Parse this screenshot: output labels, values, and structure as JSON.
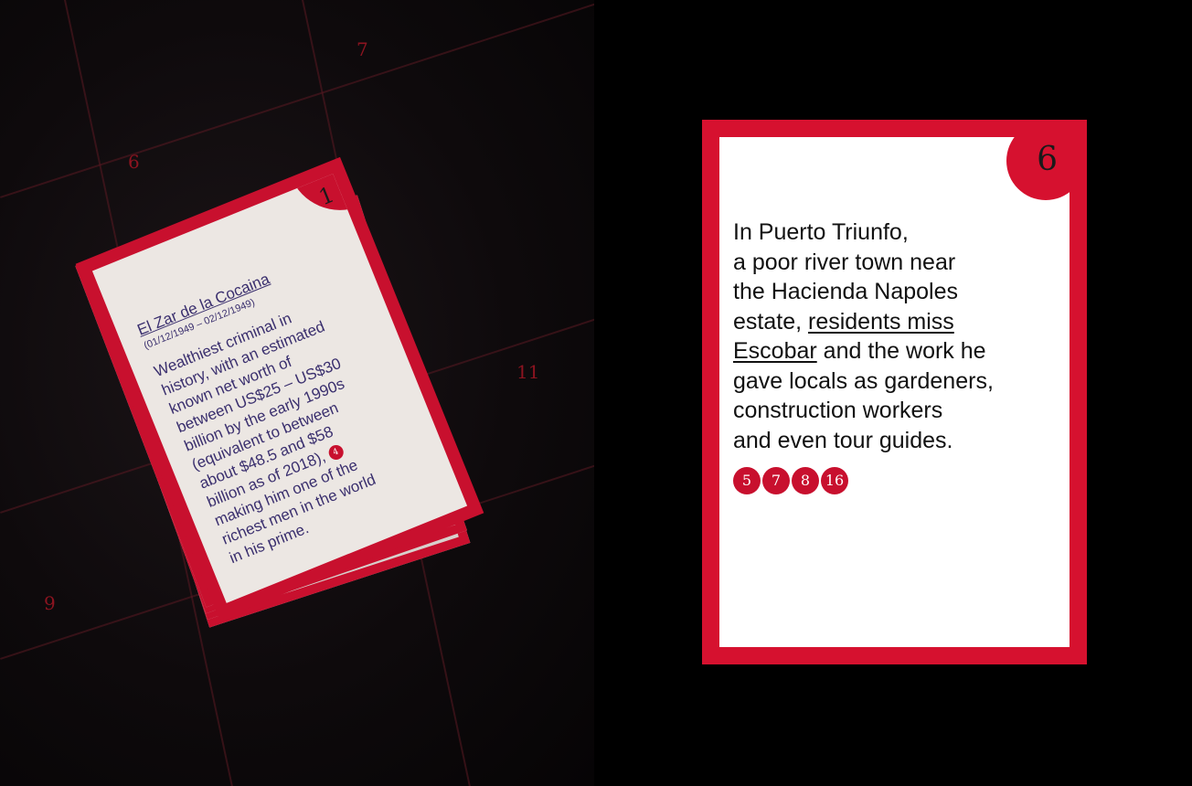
{
  "photo": {
    "grid_numbers": [
      "7",
      "6",
      "11",
      "9"
    ],
    "front_card": {
      "number": "1",
      "title": "El Zar de la Cocaina",
      "dates": "(01/12/1949 – 02/12/1949)",
      "body_lines": [
        "Wealthiest criminal in",
        "history, with an estimated",
        "known net worth of",
        "between US$25 – US$30",
        "billion by the early 1990s",
        "(equivalent to between",
        "about $48.5 and $58",
        "billion as of 2018),",
        "making him one of the",
        "richest men in the world",
        "in his prime."
      ],
      "ref_dot": "4"
    }
  },
  "card": {
    "number": "6",
    "lines": {
      "l1": "In Puerto Triunfo,",
      "l2": "a poor river town near",
      "l3": "the Hacienda Napoles",
      "l4a": "estate, ",
      "l4b": "residents miss ",
      "l5a": "Escobar",
      "l5b": " and the work he",
      "l6": "gave locals as gardeners,",
      "l7": "construction workers",
      "l8": "and even tour guides."
    },
    "refs": [
      "5",
      "7",
      "8",
      "16"
    ],
    "colors": {
      "accent": "#d6112f",
      "card_bg": "#ffffff",
      "page_bg": "#000000"
    }
  }
}
